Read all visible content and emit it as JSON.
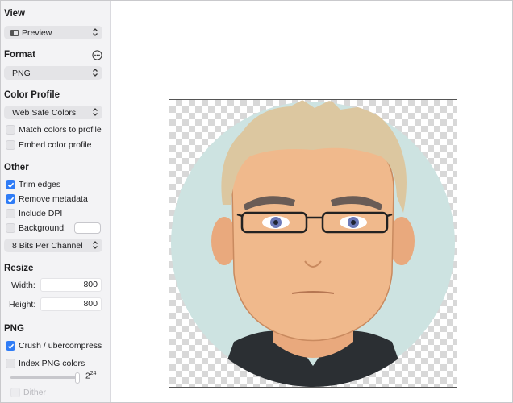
{
  "sidebar": {
    "view": {
      "title": "View",
      "value": "Preview"
    },
    "format": {
      "title": "Format",
      "value": "PNG"
    },
    "color_profile": {
      "title": "Color Profile",
      "value": "Web Safe Colors",
      "match_label": "Match colors to profile",
      "match_checked": false,
      "embed_label": "Embed color profile",
      "embed_checked": false
    },
    "other": {
      "title": "Other",
      "trim_label": "Trim edges",
      "trim_checked": true,
      "remove_label": "Remove metadata",
      "remove_checked": true,
      "dpi_label": "Include DPI",
      "dpi_checked": false,
      "background_label": "Background:",
      "background_checked": false,
      "background_color": "#ffffff",
      "bits_value": "8 Bits Per Channel"
    },
    "resize": {
      "title": "Resize",
      "width_label": "Width:",
      "width_value": "800",
      "height_label": "Height:",
      "height_value": "800"
    },
    "png": {
      "title": "PNG",
      "crush_label": "Crush / übercompress",
      "crush_checked": true,
      "index_label": "Index PNG colors",
      "index_checked": false,
      "colors_base": "2",
      "colors_exp": "24",
      "dither_label": "Dither",
      "dither_checked": false
    }
  },
  "colors": {
    "accent": "#2f7cf6",
    "avatar_bg": "#cde3e1",
    "hair": "#dcc7a0",
    "skin": "#f0b98c",
    "shirt": "#2b2f33"
  }
}
